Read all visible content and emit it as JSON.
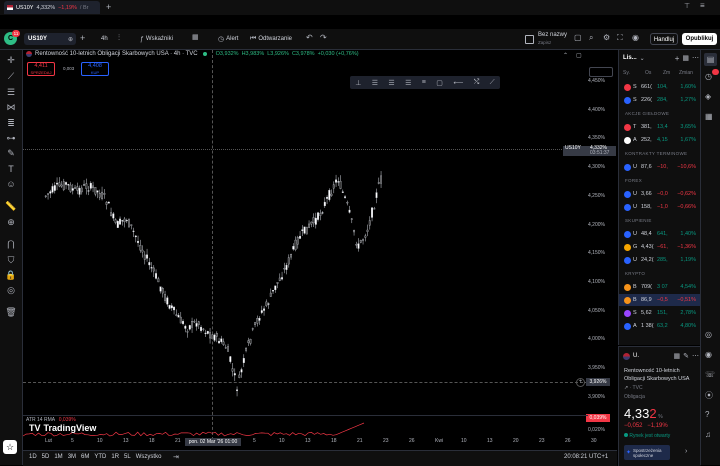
{
  "browser_tab": {
    "title": "US10Y",
    "price": "4,332%",
    "change": "−1,19%",
    "extra": "/ Br"
  },
  "toolbar": {
    "symbol": "US10Y",
    "interval": "4h",
    "indicators_label": "Wskaźniki",
    "alert_label": "Alert",
    "replay_label": "Odtwarzanie",
    "layout_name": "Bez nazwy",
    "layout_sub": "Zapisz",
    "trade_label": "Handluj",
    "publish_label": "Opublikuj",
    "avatar_badge": "11"
  },
  "legend": {
    "title": "Rentowność 10-letnich Obligacji Skarbowych USA · 4h · TVC",
    "o": "O3,932%",
    "h": "H3,983%",
    "l": "L3,926%",
    "c": "C3,978%",
    "chg": "+0,030 (+0,76%)",
    "sell_price": "4,411",
    "sell_label": "SPRZEDAJ",
    "spread": "0,003",
    "buy_price": "4,408",
    "buy_label": "KUP"
  },
  "y_axis": {
    "ticks": [
      "4,450%",
      "4,400%",
      "4,350%",
      "4,300%",
      "4,250%",
      "4,200%",
      "4,150%",
      "4,100%",
      "4,050%",
      "4,000%",
      "3,950%",
      "3,900%"
    ],
    "current_symbol": "US10Y",
    "current_value": "4,332%",
    "current_time": "03:51:37",
    "crosshair_value": "3,926%"
  },
  "x_axis": {
    "ticks": [
      "Lut",
      "5",
      "10",
      "13",
      "18",
      "21",
      "24",
      "Mar",
      "5",
      "10",
      "13",
      "18",
      "21",
      "23",
      "26",
      "Kwi",
      "10",
      "13",
      "20",
      "23",
      "26",
      "30"
    ],
    "cursor_label": "pon. 02 Mar '26 01:00"
  },
  "atr": {
    "label": "ATR 14 RMA",
    "value": "0,039%",
    "axis_value": "0,039%",
    "axis_low": "0,020%"
  },
  "branding": {
    "logo_text": "TradingView"
  },
  "bottom": {
    "ranges": [
      "1D",
      "5D",
      "1M",
      "3M",
      "6M",
      "YTD",
      "1R",
      "5L",
      "Wszystko"
    ],
    "clock": "20:08:21 UTC+1"
  },
  "watchlist": {
    "title": "Lis...",
    "cols": [
      "Sy.",
      "Os",
      "Zm",
      "Zmian"
    ],
    "rows_top": [
      {
        "sym": "S",
        "last": "661(",
        "chg": "104,",
        "pct": "1,60%",
        "color": "#f23645",
        "pos": true
      },
      {
        "sym": "S",
        "last": "226(",
        "chg": "284,",
        "pct": "1,27%",
        "color": "#2962ff",
        "pos": true
      }
    ],
    "sections": [
      {
        "name": "AKCJE GIEŁDOWE",
        "rows": [
          {
            "sym": "T",
            "last": "381,",
            "chg": "13,4",
            "pct": "3,65%",
            "color": "#f23645",
            "pos": true
          },
          {
            "sym": "A",
            "last": "252,",
            "chg": "4,15",
            "pct": "1,67%",
            "color": "#ffffff",
            "pos": true
          }
        ]
      },
      {
        "name": "KONTRAKTY TERMINOWE",
        "rows": [
          {
            "sym": "U",
            "last": "87,6",
            "chg": "−10,",
            "pct": "−10,6%",
            "color": "#2962ff",
            "pos": false
          }
        ]
      },
      {
        "name": "FOREX",
        "rows": [
          {
            "sym": "U",
            "last": "3,66",
            "chg": "−0,0",
            "pct": "−0,62%",
            "color": "#2962ff",
            "pos": false
          },
          {
            "sym": "U",
            "last": "158,",
            "chg": "−1,0",
            "pct": "−0,66%",
            "color": "#2962ff",
            "pos": false
          }
        ]
      },
      {
        "name": "SKUPIENIE",
        "rows": [
          {
            "sym": "U",
            "last": "48,4",
            "chg": "641,",
            "pct": "1,40%",
            "color": "#2962ff",
            "pos": true
          },
          {
            "sym": "G",
            "last": "4,43(",
            "chg": "−61,",
            "pct": "−1,36%",
            "color": "#f7a600",
            "pos": false
          },
          {
            "sym": "U",
            "last": "24,2(",
            "chg": "285,",
            "pct": "1,19%",
            "color": "#2962ff",
            "pos": true
          }
        ]
      },
      {
        "name": "KRYPTO",
        "rows": [
          {
            "sym": "B",
            "last": "709(",
            "chg": "3 07",
            "pct": "4,54%",
            "color": "#f7931a",
            "pos": true
          },
          {
            "sym": "B",
            "last": "86,9",
            "chg": "−0,5",
            "pct": "−0,51%",
            "color": "#f7931a",
            "pos": false
          },
          {
            "sym": "S",
            "last": "5,62",
            "chg": "151,",
            "pct": "2,78%",
            "color": "#9945ff",
            "pos": true
          },
          {
            "sym": "A",
            "last": "1 38(",
            "chg": "63,2",
            "pct": "4,80%",
            "color": "#2962ff",
            "pos": true
          }
        ]
      }
    ]
  },
  "detail": {
    "sym": "U.",
    "name1": "Rentowność 10-letnich",
    "name2": "Obligacji Skarbowych USA",
    "exchange": "· TVC",
    "type": "Obligacja",
    "price_main": "4,33",
    "price_tail": "2",
    "price_unit": "%",
    "chg": "−0,052",
    "pct": "−1,19%",
    "market_status": "Rynek jest otwarty",
    "community_label": "Spostrzeżenia społeczne"
  }
}
